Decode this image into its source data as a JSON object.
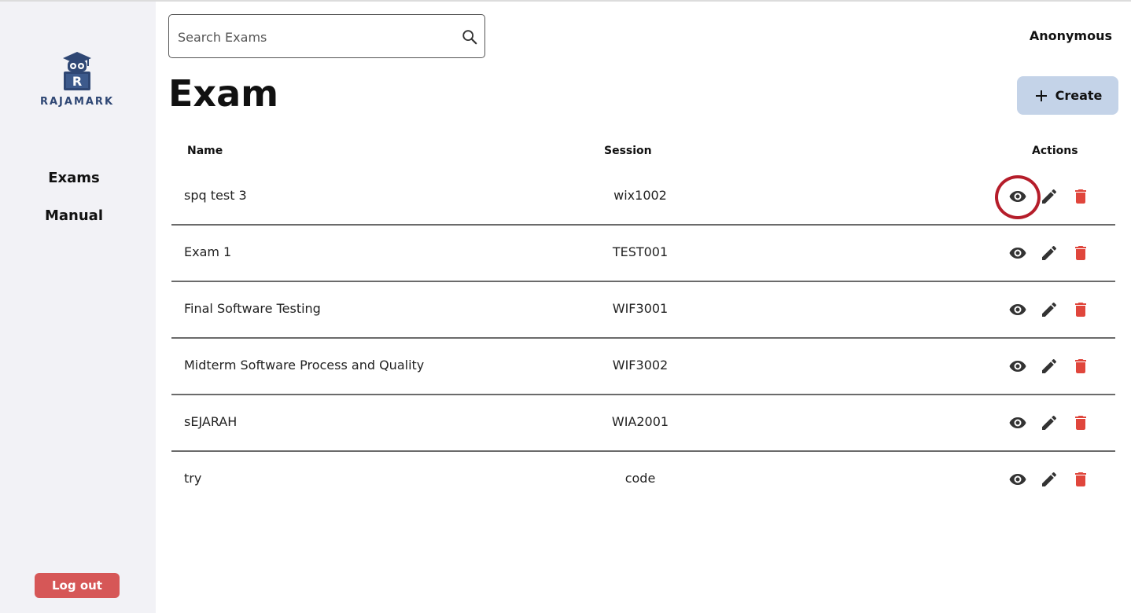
{
  "app": {
    "logo_text": "RAJAMARK"
  },
  "sidebar": {
    "items": [
      {
        "label": "Exams"
      },
      {
        "label": "Manual"
      }
    ],
    "logout_label": "Log out"
  },
  "header": {
    "search_placeholder": "Search Exams",
    "user_name": "Anonymous"
  },
  "page": {
    "title": "Exam",
    "create_label": "Create"
  },
  "table": {
    "columns": [
      "Name",
      "Session",
      "Actions"
    ],
    "rows": [
      {
        "name": "spq test 3",
        "session": "wix1002"
      },
      {
        "name": "Exam 1",
        "session": "TEST001"
      },
      {
        "name": "Final Software Testing",
        "session": "WIF3001"
      },
      {
        "name": "Midterm Software Process and Quality",
        "session": "WIF3002"
      },
      {
        "name": "sEJARAH",
        "session": "WIA2001"
      },
      {
        "name": "try",
        "session": "code"
      }
    ]
  },
  "icons": {
    "view": "eye-icon",
    "edit": "pencil-icon",
    "delete": "trash-icon",
    "search": "search-icon",
    "create": "plus-icon"
  },
  "colors": {
    "sidebar_bg": "#f2f2f6",
    "create_bg": "#c4d3e8",
    "logout_bg": "#d65757",
    "delete_icon": "#e0463c",
    "highlight_ring": "#b51d2a",
    "logo_blue": "#2f4774"
  }
}
